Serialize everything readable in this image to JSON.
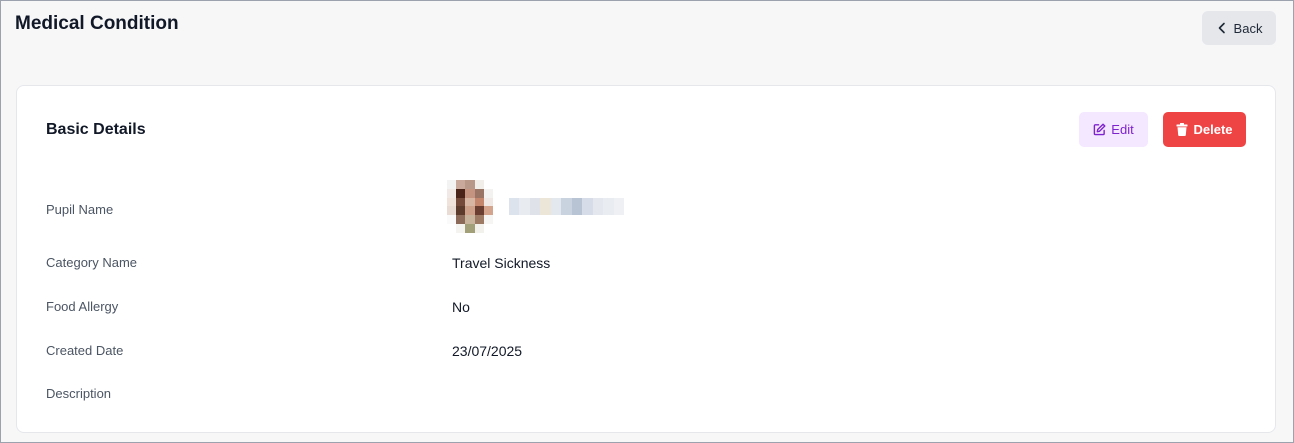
{
  "header": {
    "title": "Medical Condition",
    "back_label": "Back"
  },
  "card": {
    "title": "Basic Details",
    "edit_label": "Edit",
    "delete_label": "Delete"
  },
  "details": {
    "pupil_name_label": "Pupil Name",
    "category_name_label": "Category Name",
    "category_name_value": "Travel Sickness",
    "food_allergy_label": "Food Allergy",
    "food_allergy_value": "No",
    "created_date_label": "Created Date",
    "created_date_value": "23/07/2025",
    "description_label": "Description",
    "description_value": ""
  },
  "colors": {
    "delete": "#ef4444",
    "edit_bg": "#f3e8ff",
    "edit_text": "#7e22ce"
  }
}
